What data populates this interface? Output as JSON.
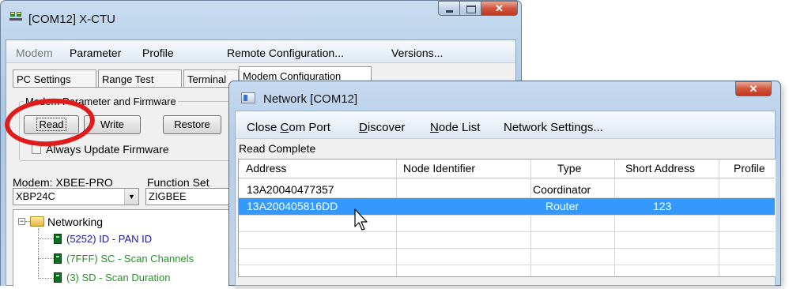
{
  "main_window": {
    "title": "[COM12] X-CTU",
    "menu": [
      "Modem",
      "Parameter",
      "Profile",
      "Remote Configuration...",
      "Versions..."
    ],
    "tabs": [
      "PC Settings",
      "Range Test",
      "Terminal",
      "Modem Configuration"
    ],
    "group_legend": "Modem Parameter and Firmware",
    "buttons": {
      "read": "Read",
      "write": "Write",
      "restore": "Restore"
    },
    "checkbox_label": "Always Update Firmware",
    "modem_label": "Modem: XBEE-PRO",
    "function_set_label": "Function Set",
    "modem_value": "XBP24C",
    "function_set_value": "ZIGBEE",
    "tree": {
      "folder": "Networking",
      "items": [
        "(5252) ID - PAN ID",
        "(7FFF) SC - Scan Channels",
        "(3) SD - Scan Duration"
      ]
    }
  },
  "network_window": {
    "title": "Network [COM12]",
    "menu": [
      {
        "pre": "Close ",
        "u": "C",
        "post": "om Port"
      },
      {
        "pre": "",
        "u": "D",
        "post": "iscover"
      },
      {
        "pre": "",
        "u": "N",
        "post": "ode List"
      },
      {
        "pre": "Network Settings...",
        "u": "",
        "post": ""
      }
    ],
    "status": "Read Complete",
    "columns": [
      "Address",
      "Node Identifier",
      "Type",
      "Short Address",
      "Profile"
    ],
    "rows": [
      {
        "address": "13A20040477357",
        "node_identifier": "",
        "type": "Coordinator",
        "short_address": "",
        "profile": "",
        "selected": false
      },
      {
        "address": "13A200405816DD",
        "node_identifier": "",
        "type": "Router",
        "short_address": "123",
        "profile": "",
        "selected": true
      }
    ]
  },
  "colors": {
    "highlight_ring": "#e01b1b",
    "selection": "#3399ff",
    "tree_blue": "#1a1aa8",
    "tree_green": "#1f9a23"
  }
}
